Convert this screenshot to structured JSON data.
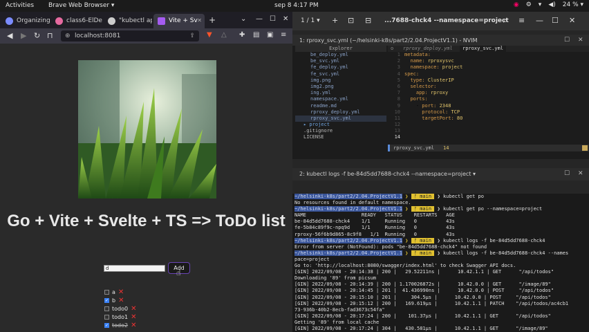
{
  "topbar": {
    "activities": "Activities",
    "app_name": "Brave Web Browser ▾",
    "clock": "sep 8  4:17 PM",
    "battery": "24 % ▾"
  },
  "browser": {
    "tabs": [
      {
        "label": "Organizing",
        "color": "#7b8cff"
      },
      {
        "label": "class6-ElDe",
        "color": "#e66aa0"
      },
      {
        "label": "\"kubectl ap",
        "color": "#ccc"
      },
      {
        "label": "Vite + Sv",
        "color": "#a55cf0"
      }
    ],
    "url": "localhost:8081",
    "page": {
      "heading": "Go + Vite + Svelte + TS => ToDo list",
      "input_value": "d",
      "add_label": "Add",
      "todos": [
        {
          "label": "a",
          "checked": false,
          "done": false
        },
        {
          "label": "b",
          "checked": true,
          "done": false
        },
        {
          "label": "todo0",
          "checked": false,
          "done": false
        },
        {
          "label": "todo1",
          "checked": false,
          "done": false
        },
        {
          "label": "todo2",
          "checked": true,
          "done": true
        }
      ]
    }
  },
  "terminal": {
    "page_indicator": "1 / 1 ▾",
    "window_title": "...7688-chck4 --namespace=project",
    "pane1_title": "1: rproxy_svc.yml (~/helsinki-k8s/part2/2.04.ProjectV1.1) - NVIM",
    "explorer_header": "Explorer",
    "explorer_items": [
      "be_deploy.yml",
      "be_svc.yml",
      "fe_deploy.yml",
      "fe_svc.yml",
      "img.png",
      "img2.png",
      "ing.yml",
      "namespace.yml",
      "readme.md",
      "rproxy_deploy.yml",
      "rproxy_svc.yml"
    ],
    "explorer_dirs": [
      "▸ project",
      ".gitignore",
      "LICENSE"
    ],
    "buffer_tabs": [
      "o",
      "rproxy_deploy.yml",
      "rproxy_svc.yml"
    ],
    "code_lines": [
      {
        "n": "1",
        "text": "metadata:"
      },
      {
        "n": "2",
        "text": "  name: rproxysvc"
      },
      {
        "n": "3",
        "text": "  namespace: project"
      },
      {
        "n": "4",
        "text": "spec:"
      },
      {
        "n": "5",
        "text": "  type: ClusterIP"
      },
      {
        "n": "6",
        "text": "  selector:"
      },
      {
        "n": "7",
        "text": "    app: rproxy"
      },
      {
        "n": "8",
        "text": "  ports:"
      },
      {
        "n": "9",
        "text": "    - port: 2348"
      },
      {
        "n": "10",
        "text": "      protocol: TCP"
      },
      {
        "n": "11",
        "text": "      targetPort: 80"
      },
      {
        "n": "12",
        "text": ""
      },
      {
        "n": "13",
        "text": ""
      },
      {
        "n": "14",
        "text": ""
      }
    ],
    "status_file": "rproxy_svc.yml",
    "status_line": "14",
    "pane2_title": "2: kubectl logs -f be-84d5dd7688-chck4 --namespace=project  ▾",
    "log_lines": [
      {
        "path": "~/helsinki-k8s/part2/2.04.ProjectV1.1",
        "branch": "main",
        "cmd": "kubectl get po"
      },
      {
        "text": "No resources found in default namespace."
      },
      {
        "path": "~/helsinki-k8s/part2/2.04.ProjectV1.1",
        "branch": "main",
        "cmd": "kubectl get po --namespace=project"
      },
      {
        "text": "NAME                   READY   STATUS    RESTARTS   AGE"
      },
      {
        "text": "be-84d5dd7688-chck4    1/1     Running   0          43s"
      },
      {
        "text": "fe-5b84c89f9c-npq9d    1/1     Running   0          43s"
      },
      {
        "text": "rproxy-56f6b9d865-8c9f8   1/1  Running   0          43s"
      },
      {
        "path": "~/helsinki-k8s/part2/2.04.ProjectV1.1",
        "branch": "main",
        "cmd": "kubectl logs -f be-84d5dd7688-chck4"
      },
      {
        "text": "Error from server (NotFound): pods \"be-84d5dd7688-chck4\" not found"
      },
      {
        "path": "~/helsinki-k8s/part2/2.04.ProjectV1.1",
        "branch": "main",
        "cmd": "kubectl logs -f be-84d5dd7688-chck4 --names"
      },
      {
        "text": "pace=project"
      },
      {
        "text": "Go to: 'http://localhost:8080/swagger/index.html' to check Swagger API docs."
      },
      {
        "text": "[GIN] 2022/09/08 - 20:14:38 | 200 |   29.52211ns |      10.42.1.1 | GET      \"/api/todos\""
      },
      {
        "text": "Downloading '89' from picsum"
      },
      {
        "text": "[GIN] 2022/09/08 - 20:14:39 | 200 | 1.170026872s |      10.42.0.0 | GET      \"/image/89\""
      },
      {
        "text": "[GIN] 2022/09/08 - 20:14:45 | 201 |  41.436990ns |      10.42.0.0 | POST     \"/api/todos\""
      },
      {
        "text": "[GIN] 2022/09/08 - 20:15:10 | 201 |     304.5µs |      10.42.0.0 | POST     \"/api/todos\""
      },
      {
        "text": "[GIN] 2022/09/08 - 20:15:12 | 200 |   169.619µs |      10.42.1.1 | PATCH    \"/api/todos/ac4cb1"
      },
      {
        "text": "73-936b-40b2-8ecb-fad3673c54fa\""
      },
      {
        "text": "[GIN] 2022/09/08 - 20:17:24 | 200 |    101.37µs |      10.42.1.1 | GET      \"/api/todos\""
      },
      {
        "text": "Getting '89' from local cache"
      },
      {
        "text": "[GIN] 2022/09/08 - 20:17:24 | 304 |   430.581µs |      10.42.1.1 | GET      \"/image/89\""
      },
      {
        "text": "▯"
      }
    ]
  }
}
